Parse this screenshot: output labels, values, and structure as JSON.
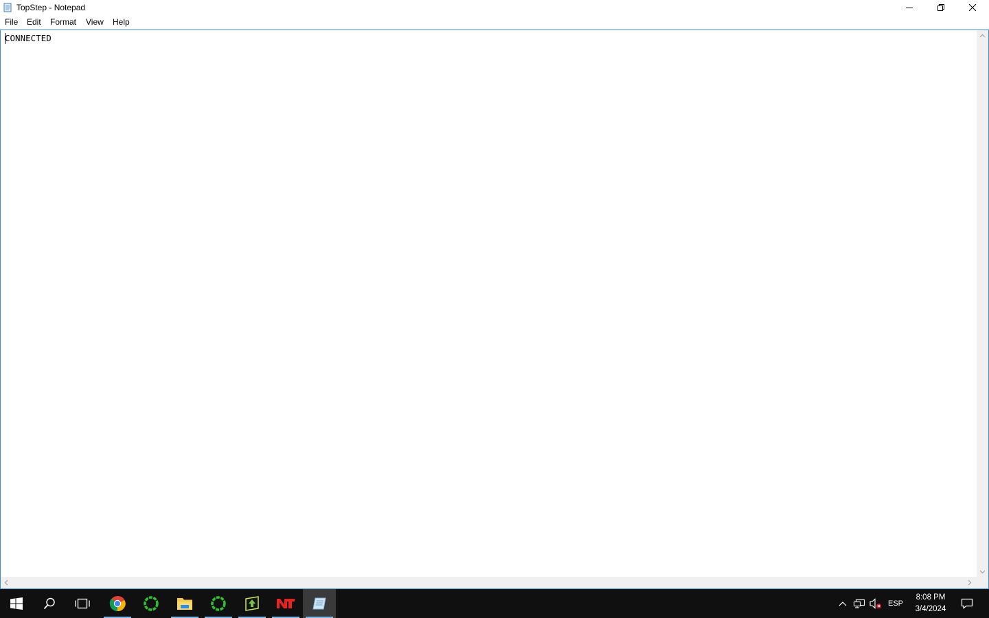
{
  "window": {
    "title": "TopStep - Notepad",
    "icon": "notepad-icon"
  },
  "menu": {
    "file": "File",
    "edit": "Edit",
    "format": "Format",
    "view": "View",
    "help": "Help"
  },
  "editor": {
    "content": "CONNECTED"
  },
  "taskbar": {
    "apps": [
      {
        "name": "start-button",
        "icon": "windows-logo-icon"
      },
      {
        "name": "search-button",
        "icon": "search-icon"
      },
      {
        "name": "task-view-button",
        "icon": "task-view-icon"
      },
      {
        "name": "chrome",
        "icon": "chrome-icon",
        "open": true
      },
      {
        "name": "green-ring-app-1",
        "icon": "green-ring-icon"
      },
      {
        "name": "file-explorer",
        "icon": "folder-icon",
        "open": true
      },
      {
        "name": "green-ring-app-2",
        "icon": "green-ring-icon",
        "open": true
      },
      {
        "name": "green-arrow-app",
        "icon": "green-arrow-icon",
        "open": true
      },
      {
        "name": "ninjatrader",
        "icon": "nt-logo-icon",
        "open": true
      },
      {
        "name": "notepad",
        "icon": "notepad-icon",
        "open": true,
        "active": true
      }
    ],
    "tray": {
      "language": "ESP",
      "time": "8:08 PM",
      "date": "3/4/2024"
    }
  },
  "colors": {
    "accent": "#3c8fd8",
    "taskbar": "#101010",
    "running_indicator": "#76b9ed"
  }
}
